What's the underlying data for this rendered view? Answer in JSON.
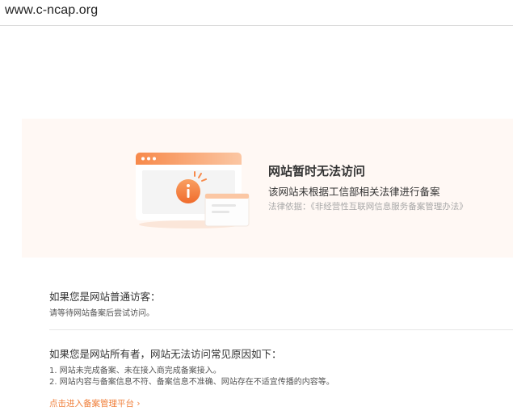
{
  "browser": {
    "url": "www.c-ncap.org"
  },
  "banner": {
    "title": "网站暂时无法访问",
    "description": "该网站未根据工信部相关法律进行备案",
    "law": "法律依据：《非经营性互联网信息服务备案管理办法》"
  },
  "visitor": {
    "heading": "如果您是网站普通访客：",
    "text": "请等待网站备案后尝试访问。"
  },
  "owner": {
    "heading": "如果您是网站所有者，网站无法访问常见原因如下：",
    "reasons": [
      "1. 网站未完成备案、未在接入商完成备案接入。",
      "2. 网站内容与备案信息不符、备案信息不准确、网站存在不适宜传播的内容等。"
    ]
  },
  "link": {
    "label": "点击进入备案管理平台 ›"
  },
  "colors": {
    "accent": "#f0813d",
    "banner_bg": "#fff8f4"
  }
}
